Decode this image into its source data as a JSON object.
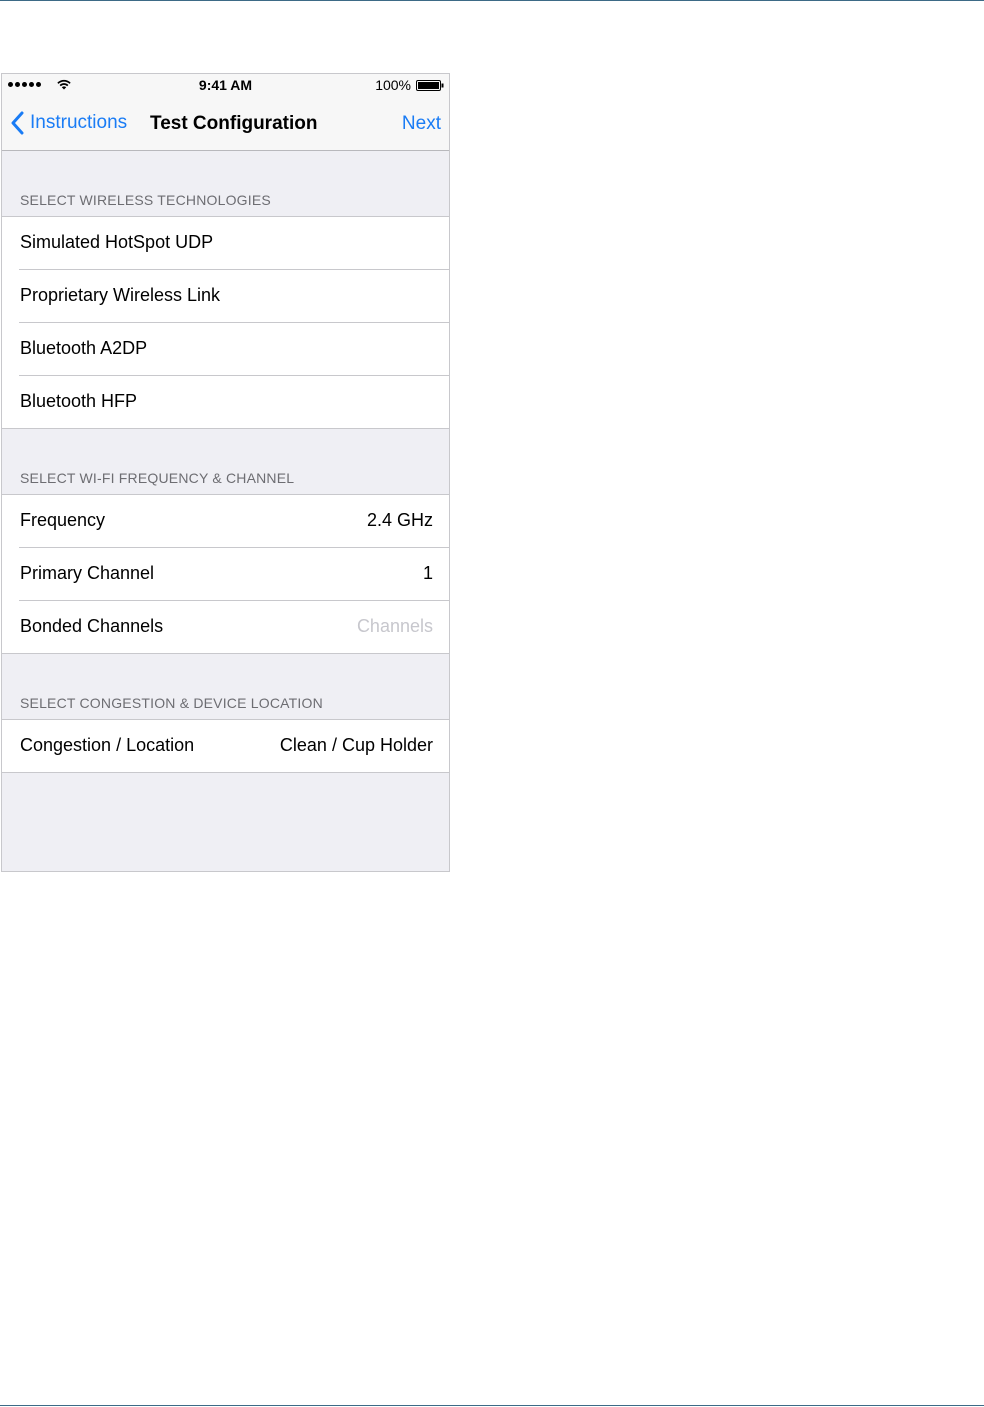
{
  "status_bar": {
    "time": "9:41 AM",
    "battery_percent": "100%",
    "signal_bars": 5,
    "icons": [
      "signal-dots-icon",
      "wifi-icon",
      "battery-icon"
    ]
  },
  "nav": {
    "back_label": "Instructions",
    "title": "Test Configuration",
    "next_label": "Next",
    "accent_color": "#1a7cf5"
  },
  "sections": [
    {
      "header": "SELECT WIRELESS TECHNOLOGIES",
      "rows": [
        {
          "label": "Simulated HotSpot UDP"
        },
        {
          "label": "Proprietary Wireless Link"
        },
        {
          "label": "Bluetooth A2DP"
        },
        {
          "label": "Bluetooth HFP"
        }
      ]
    },
    {
      "header": "SELECT WI-FI FREQUENCY & CHANNEL",
      "rows": [
        {
          "label": "Frequency",
          "value": "2.4 GHz"
        },
        {
          "label": "Primary Channel",
          "value": "1"
        },
        {
          "label": "Bonded Channels",
          "placeholder": "Channels"
        }
      ]
    },
    {
      "header": "SELECT CONGESTION & DEVICE LOCATION",
      "rows": [
        {
          "label": "Congestion / Location",
          "value": "Clean / Cup Holder"
        }
      ]
    }
  ]
}
